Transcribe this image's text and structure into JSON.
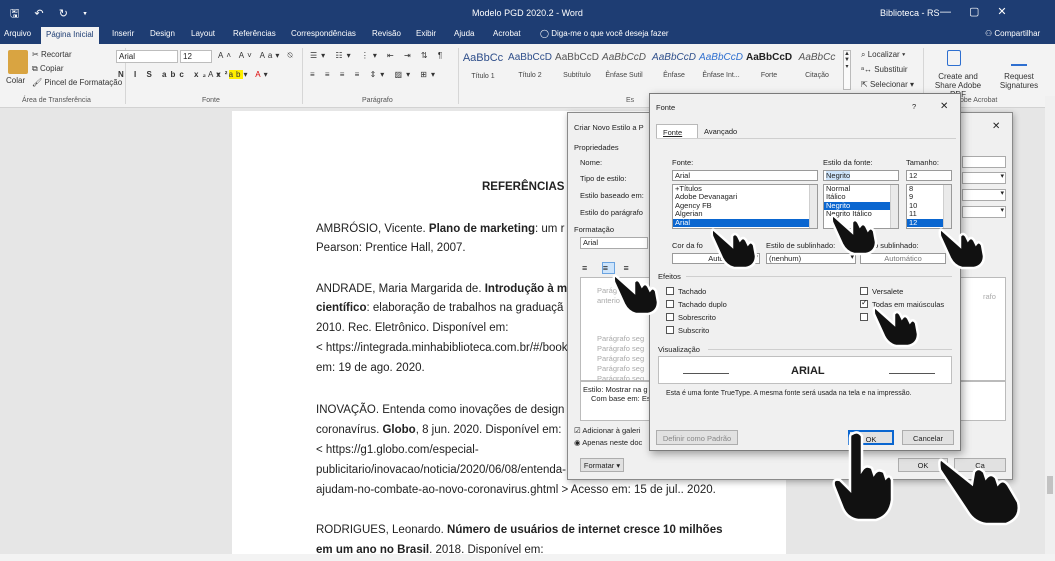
{
  "titlebar": {
    "qat": "🖫 ↶ ↻ ▾",
    "doc_title": "Modelo PGD 2020.2 - Word",
    "user": "Biblioteca - RS",
    "min": "—",
    "max": "▢",
    "close": "✕"
  },
  "tabs": [
    "Arquivo",
    "Página Inicial",
    "Inserir",
    "Design",
    "Layout",
    "Referências",
    "Correspondências",
    "Revisão",
    "Exibir",
    "Ajuda",
    "Acrobat",
    "Diga-me o que você deseja fazer"
  ],
  "share_label": "Compartilhar",
  "ribbon": {
    "clipboard": {
      "paste": "Colar",
      "cut": "Recortar",
      "copy": "Copiar",
      "format_painter": "Pincel de Formatação",
      "group": "Área de Transferência"
    },
    "font": {
      "name": "Arial",
      "size": "12",
      "group": "Fonte"
    },
    "paragraph": {
      "group": "Parágrafo"
    },
    "styles": [
      {
        "sample": "AaBbCc",
        "name": "Título 1"
      },
      {
        "sample": "AaBbCcD",
        "name": "Título 2"
      },
      {
        "sample": "AaBbCcD",
        "name": "Subtítulo"
      },
      {
        "sample": "AaBbCcD",
        "name": "Ênfase Sutil"
      },
      {
        "sample": "AaBbCcD",
        "name": "Ênfase"
      },
      {
        "sample": "AaBbCcD",
        "name": "Ênfase Int..."
      },
      {
        "sample": "AaBbCcD",
        "name": "Forte"
      },
      {
        "sample": "AaBbCc",
        "name": "Citação"
      }
    ],
    "editing": {
      "find": "Localizar",
      "replace": "Substituir",
      "select": "Selecionar"
    },
    "acrobat": {
      "create_share": "Create and Share Adobe PDF",
      "request_sig": "Request Signatures",
      "group": "obe Acrobat"
    },
    "styles_group_partial": "Es"
  },
  "document": {
    "title": "REFERÊNCIAS",
    "lines": [
      "AMBRÓSIO, Vicente. Plano de marketing: um r",
      "Pearson: Prentice Hall, 2007.",
      "ANDRADE, Maria Margarida de. Introdução à m",
      "científico: elaboração de trabalhos na graduaçã",
      "2010. Rec. Eletrônico. Disponível em:",
      "< https://integrada.minhabiblioteca.com.br/#/book",
      "em: 19 de ago. 2020.",
      "INOVAÇÃO. Entenda como inovações de design",
      "coronavírus. Globo, 8 jun. 2020. Disponível em:",
      "< https://g1.globo.com/especial-",
      "publicitario/inovacao/noticia/2020/06/08/entenda-",
      "ajudam-no-combate-ao-novo-coronavirus.ghtml > Acesso em: 15 de jul.. 2020.",
      "RODRIGUES, Leonardo. Número de usuários de internet cresce 10 milhões",
      "em um ano no Brasil. 2018. Disponível em:"
    ]
  },
  "style_dialog": {
    "title": "Criar Novo Estilo a P",
    "props": "Propriedades",
    "name": "Nome:",
    "type": "Tipo de estilo:",
    "based": "Estilo baseado em:",
    "next": "Estilo do parágrafo",
    "formatting": "Formatação",
    "font_value": "Arial",
    "preview_gray1": "Parágrafo ant",
    "preview_gray2": "anterio",
    "preview_lines": [
      "Parágrafo seg",
      "Parágrafo seg",
      "Parágrafo seg",
      "Parágrafo seg",
      "Parágrafo seg"
    ],
    "desc1": "Estilo: Mostrar na g",
    "desc2": "Com base em: Es",
    "add_gallery": "Adicionar à galeri",
    "only_doc": "Apenas neste doc",
    "format_btn": "Formatar ▾",
    "ok": "OK",
    "cancel": "Ca",
    "right_hint": "rafo"
  },
  "font_dialog": {
    "title": "Fonte",
    "help": "?",
    "close": "✕",
    "tab_font": "Fonte",
    "tab_adv": "Avançado",
    "font_label": "Fonte:",
    "font_value": "Arial",
    "font_list": [
      "+Títulos",
      "Adobe Devanagari",
      "Agency FB",
      "Algerian",
      "Arial"
    ],
    "style_label": "Estilo da fonte:",
    "style_value": "Negrito",
    "style_list": [
      "Normal",
      "Itálico",
      "Negrito",
      "Negrito Itálico"
    ],
    "size_label": "Tamanho:",
    "size_value": "12",
    "size_list": [
      "8",
      "9",
      "10",
      "11",
      "12"
    ],
    "color_label": "Cor da fo",
    "color_value": "Auto",
    "underline_label": "Estilo de sublinhado:",
    "underline_value": "(nenhum)",
    "underline_color_label": "o sublinhado:",
    "underline_color_value": "Automático",
    "effects_label": "Efeitos",
    "effects_left": [
      {
        "label": "Tachado",
        "checked": false
      },
      {
        "label": "Tachado duplo",
        "checked": false
      },
      {
        "label": "Sobrescrito",
        "checked": false
      },
      {
        "label": "Subscrito",
        "checked": false
      }
    ],
    "effects_right": [
      {
        "label": "Versalete",
        "checked": false
      },
      {
        "label": "Todas em maiúsculas",
        "checked": true
      },
      {
        "label": "",
        "checked": false
      }
    ],
    "preview_label": "Visualização",
    "preview_text": "ARIAL",
    "preview_note": "Esta é uma fonte TrueType. A mesma fonte será usada na tela e na impressão.",
    "default_btn": "Definir como Padrão",
    "ok": "OK",
    "cancel": "Cancelar"
  }
}
